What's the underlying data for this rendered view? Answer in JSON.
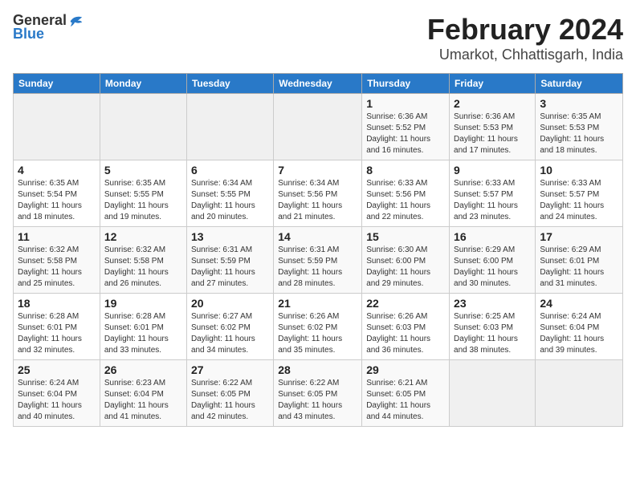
{
  "logo": {
    "line1": "General",
    "line2": "Blue"
  },
  "title": "February 2024",
  "subtitle": "Umarkot, Chhattisgarh, India",
  "days_of_week": [
    "Sunday",
    "Monday",
    "Tuesday",
    "Wednesday",
    "Thursday",
    "Friday",
    "Saturday"
  ],
  "weeks": [
    [
      {
        "day": "",
        "info": ""
      },
      {
        "day": "",
        "info": ""
      },
      {
        "day": "",
        "info": ""
      },
      {
        "day": "",
        "info": ""
      },
      {
        "day": "1",
        "info": "Sunrise: 6:36 AM\nSunset: 5:52 PM\nDaylight: 11 hours\nand 16 minutes."
      },
      {
        "day": "2",
        "info": "Sunrise: 6:36 AM\nSunset: 5:53 PM\nDaylight: 11 hours\nand 17 minutes."
      },
      {
        "day": "3",
        "info": "Sunrise: 6:35 AM\nSunset: 5:53 PM\nDaylight: 11 hours\nand 18 minutes."
      }
    ],
    [
      {
        "day": "4",
        "info": "Sunrise: 6:35 AM\nSunset: 5:54 PM\nDaylight: 11 hours\nand 18 minutes."
      },
      {
        "day": "5",
        "info": "Sunrise: 6:35 AM\nSunset: 5:55 PM\nDaylight: 11 hours\nand 19 minutes."
      },
      {
        "day": "6",
        "info": "Sunrise: 6:34 AM\nSunset: 5:55 PM\nDaylight: 11 hours\nand 20 minutes."
      },
      {
        "day": "7",
        "info": "Sunrise: 6:34 AM\nSunset: 5:56 PM\nDaylight: 11 hours\nand 21 minutes."
      },
      {
        "day": "8",
        "info": "Sunrise: 6:33 AM\nSunset: 5:56 PM\nDaylight: 11 hours\nand 22 minutes."
      },
      {
        "day": "9",
        "info": "Sunrise: 6:33 AM\nSunset: 5:57 PM\nDaylight: 11 hours\nand 23 minutes."
      },
      {
        "day": "10",
        "info": "Sunrise: 6:33 AM\nSunset: 5:57 PM\nDaylight: 11 hours\nand 24 minutes."
      }
    ],
    [
      {
        "day": "11",
        "info": "Sunrise: 6:32 AM\nSunset: 5:58 PM\nDaylight: 11 hours\nand 25 minutes."
      },
      {
        "day": "12",
        "info": "Sunrise: 6:32 AM\nSunset: 5:58 PM\nDaylight: 11 hours\nand 26 minutes."
      },
      {
        "day": "13",
        "info": "Sunrise: 6:31 AM\nSunset: 5:59 PM\nDaylight: 11 hours\nand 27 minutes."
      },
      {
        "day": "14",
        "info": "Sunrise: 6:31 AM\nSunset: 5:59 PM\nDaylight: 11 hours\nand 28 minutes."
      },
      {
        "day": "15",
        "info": "Sunrise: 6:30 AM\nSunset: 6:00 PM\nDaylight: 11 hours\nand 29 minutes."
      },
      {
        "day": "16",
        "info": "Sunrise: 6:29 AM\nSunset: 6:00 PM\nDaylight: 11 hours\nand 30 minutes."
      },
      {
        "day": "17",
        "info": "Sunrise: 6:29 AM\nSunset: 6:01 PM\nDaylight: 11 hours\nand 31 minutes."
      }
    ],
    [
      {
        "day": "18",
        "info": "Sunrise: 6:28 AM\nSunset: 6:01 PM\nDaylight: 11 hours\nand 32 minutes."
      },
      {
        "day": "19",
        "info": "Sunrise: 6:28 AM\nSunset: 6:01 PM\nDaylight: 11 hours\nand 33 minutes."
      },
      {
        "day": "20",
        "info": "Sunrise: 6:27 AM\nSunset: 6:02 PM\nDaylight: 11 hours\nand 34 minutes."
      },
      {
        "day": "21",
        "info": "Sunrise: 6:26 AM\nSunset: 6:02 PM\nDaylight: 11 hours\nand 35 minutes."
      },
      {
        "day": "22",
        "info": "Sunrise: 6:26 AM\nSunset: 6:03 PM\nDaylight: 11 hours\nand 36 minutes."
      },
      {
        "day": "23",
        "info": "Sunrise: 6:25 AM\nSunset: 6:03 PM\nDaylight: 11 hours\nand 38 minutes."
      },
      {
        "day": "24",
        "info": "Sunrise: 6:24 AM\nSunset: 6:04 PM\nDaylight: 11 hours\nand 39 minutes."
      }
    ],
    [
      {
        "day": "25",
        "info": "Sunrise: 6:24 AM\nSunset: 6:04 PM\nDaylight: 11 hours\nand 40 minutes."
      },
      {
        "day": "26",
        "info": "Sunrise: 6:23 AM\nSunset: 6:04 PM\nDaylight: 11 hours\nand 41 minutes."
      },
      {
        "day": "27",
        "info": "Sunrise: 6:22 AM\nSunset: 6:05 PM\nDaylight: 11 hours\nand 42 minutes."
      },
      {
        "day": "28",
        "info": "Sunrise: 6:22 AM\nSunset: 6:05 PM\nDaylight: 11 hours\nand 43 minutes."
      },
      {
        "day": "29",
        "info": "Sunrise: 6:21 AM\nSunset: 6:05 PM\nDaylight: 11 hours\nand 44 minutes."
      },
      {
        "day": "",
        "info": ""
      },
      {
        "day": "",
        "info": ""
      }
    ]
  ]
}
